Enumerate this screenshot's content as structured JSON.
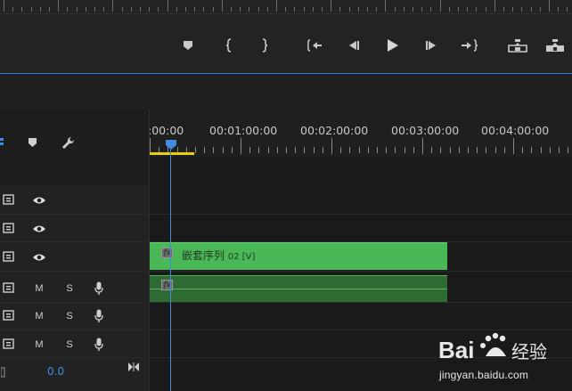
{
  "ruler": {
    "timecodes": [
      ":00:00",
      "00:01:00:00",
      "00:02:00:00",
      "00:03:00:00",
      "00:04:00:00"
    ]
  },
  "toolbar": {
    "icons": [
      "marker-icon",
      "in-point-icon",
      "out-point-icon",
      "go-to-in-icon",
      "step-back-icon",
      "play-icon",
      "step-forward-icon",
      "go-to-out-icon",
      "lift-icon",
      "extract-icon"
    ]
  },
  "tracks": {
    "video": [
      {
        "name": "video-track-3",
        "eye": "eye-icon"
      },
      {
        "name": "video-track-2",
        "eye": "eye-icon"
      },
      {
        "name": "video-track-1",
        "eye": "eye-icon"
      }
    ],
    "audio": [
      {
        "name": "audio-track-1",
        "mute": "M",
        "solo": "S"
      },
      {
        "name": "audio-track-2",
        "mute": "M",
        "solo": "S"
      },
      {
        "name": "audio-track-3",
        "mute": "M",
        "solo": "S"
      }
    ]
  },
  "clip": {
    "fx": "fx",
    "label": "嵌套序列",
    "label_sub": "02 [V]"
  },
  "master": {
    "value": "0.0"
  },
  "colors": {
    "clip_video": "#4bb857",
    "clip_audio": "#2e6a33",
    "playhead": "#3d8cdf",
    "work_area": "#e8d20f",
    "accent": "#3e8fe3"
  },
  "watermark": {
    "brand": "Bai du 经验",
    "url": "jingyan.baidu.com"
  }
}
